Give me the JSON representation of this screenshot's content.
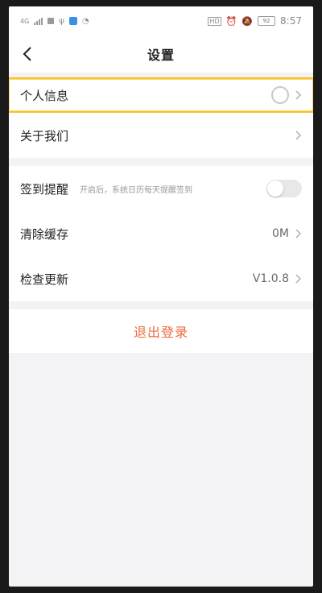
{
  "status_bar": {
    "network": "4G",
    "battery": "92",
    "time": "8:57"
  },
  "header": {
    "title": "设置"
  },
  "sections": [
    {
      "items": [
        {
          "label": "个人信息"
        },
        {
          "label": "关于我们"
        }
      ]
    },
    {
      "items": [
        {
          "label": "签到提醒",
          "hint": "开启后，系统日历每天提醒签到",
          "toggle_on": false
        },
        {
          "label": "清除缓存",
          "value": "0M"
        },
        {
          "label": "检查更新",
          "value": "V1.0.8"
        }
      ]
    }
  ],
  "logout": {
    "label": "退出登录"
  },
  "colors": {
    "accent": "#ef6a3c",
    "highlight_border": "#f6c52b"
  }
}
